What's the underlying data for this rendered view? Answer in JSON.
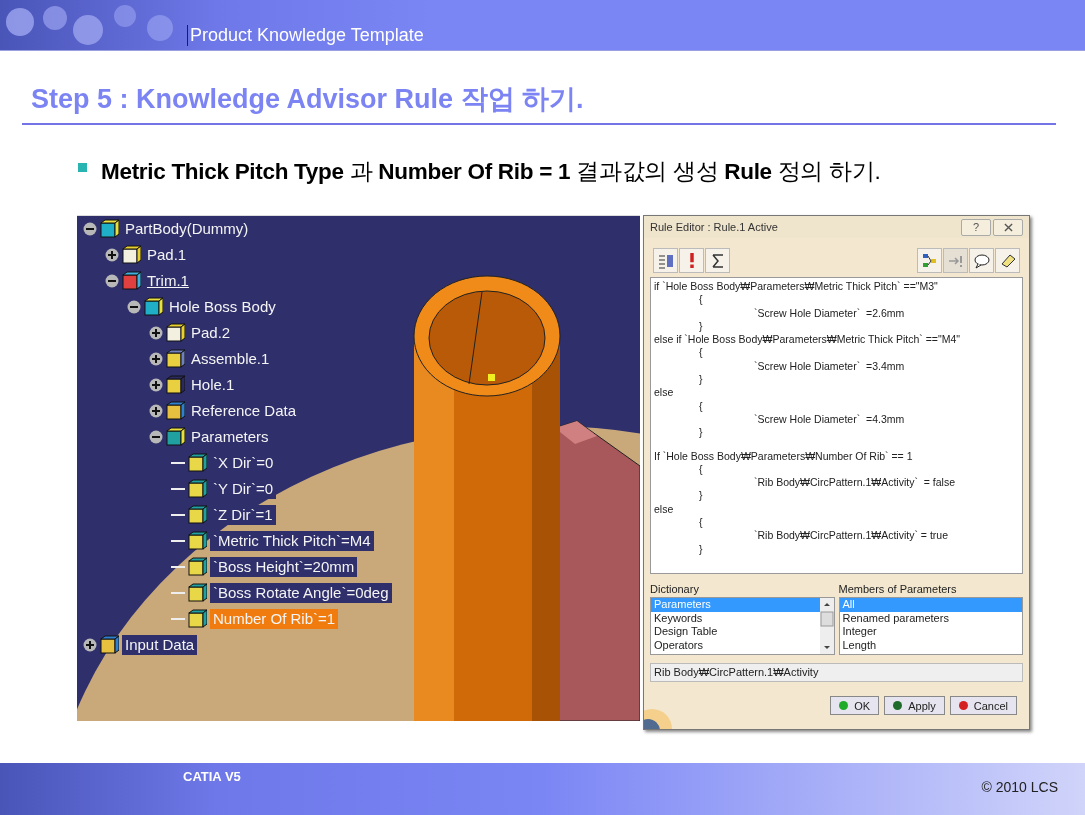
{
  "header": {
    "title": "Product Knowledge Template"
  },
  "heading": "Step 5 : Knowledge Advisor  Rule 작업 하기.",
  "bullet": "**Metric Thick Pitch Type** 과 **Number Of Rib = 1** 결과값의 생성 **Rule** 정의 하기.",
  "tree": [
    {
      "label": "PartBody(Dummy)",
      "kind": "body",
      "expanded": true,
      "selected": false,
      "children": [
        {
          "label": "Pad.1",
          "kind": "pad",
          "expanded": false,
          "selected": false
        },
        {
          "label": "Trim.1",
          "kind": "trim",
          "expanded": true,
          "selected": false,
          "in_work": true,
          "children": [
            {
              "label": "Hole Boss Body",
              "kind": "body",
              "expanded": true,
              "selected": false,
              "children": [
                {
                  "label": "Pad.2",
                  "kind": "pad",
                  "expanded": false,
                  "selected": false
                },
                {
                  "label": "Assemble.1",
                  "kind": "assemble",
                  "expanded": false,
                  "selected": false
                },
                {
                  "label": "Hole.1",
                  "kind": "hole",
                  "expanded": false,
                  "selected": false
                },
                {
                  "label": "Reference Data",
                  "kind": "reference",
                  "expanded": false,
                  "selected": false
                },
                {
                  "label": "Parameters",
                  "kind": "parameters",
                  "expanded": true,
                  "selected": false,
                  "children": [
                    {
                      "label": "`X Dir`=0",
                      "kind": "param",
                      "selected": false
                    },
                    {
                      "label": "`Y Dir`=0",
                      "kind": "param",
                      "selected": false
                    },
                    {
                      "label": "`Z Dir`=1",
                      "kind": "param",
                      "selected": false
                    },
                    {
                      "label": "`Metric Thick Pitch`=M4",
                      "kind": "param",
                      "selected": false
                    },
                    {
                      "label": "`Boss Height`=20mm",
                      "kind": "param",
                      "selected": false
                    },
                    {
                      "label": "`Boss Rotate Angle`=0deg",
                      "kind": "param",
                      "selected": false
                    },
                    {
                      "label": "Number Of Rib`=1",
                      "kind": "param",
                      "selected": true
                    }
                  ]
                }
              ]
            }
          ]
        }
      ]
    },
    {
      "label": "Input Data",
      "kind": "reference",
      "expanded": false,
      "selected": false
    }
  ],
  "dialog": {
    "title": "Rule Editor : Rule.1 Active",
    "help": "?",
    "tools_left": [
      {
        "kind": "list",
        "disabled": false
      },
      {
        "kind": "error",
        "disabled": false
      },
      {
        "kind": "sum",
        "disabled": false
      }
    ],
    "tools_right": [
      {
        "kind": "graph",
        "disabled": false
      },
      {
        "kind": "goto",
        "disabled": true
      },
      {
        "kind": "bubble",
        "disabled": false
      },
      {
        "kind": "eraser",
        "disabled": false
      }
    ],
    "code": [
      {
        "kind": "cond",
        "text": "if `Hole Boss Body₩Parameters₩Metric Thick Pitch` ==\"M3\""
      },
      {
        "kind": "brace",
        "text": "{"
      },
      {
        "kind": "stmt",
        "text": "`Screw Hole Diameter`  =2.6mm"
      },
      {
        "kind": "brace",
        "text": "}"
      },
      {
        "kind": "cond",
        "text": "else if `Hole Boss Body₩Parameters₩Metric Thick Pitch` ==\"M4\""
      },
      {
        "kind": "brace",
        "text": "{"
      },
      {
        "kind": "stmt",
        "text": "`Screw Hole Diameter`  =3.4mm"
      },
      {
        "kind": "brace",
        "text": "}"
      },
      {
        "kind": "cond",
        "text": "else"
      },
      {
        "kind": "brace",
        "text": "{"
      },
      {
        "kind": "stmt",
        "text": "`Screw Hole Diameter`  =4.3mm"
      },
      {
        "kind": "brace",
        "text": "}"
      },
      {
        "kind": "section",
        "text": "If `Hole Boss Body₩Parameters₩Number Of Rib` == 1"
      },
      {
        "kind": "brace",
        "text": "{"
      },
      {
        "kind": "stmt",
        "text": "`Rib Body₩CircPattern.1₩Activity`  = false"
      },
      {
        "kind": "brace",
        "text": "}"
      },
      {
        "kind": "cond",
        "text": "else"
      },
      {
        "kind": "brace",
        "text": "{"
      },
      {
        "kind": "stmt",
        "text": "`Rib Body₩CircPattern.1₩Activity` = true"
      },
      {
        "kind": "brace",
        "text": "}"
      }
    ],
    "dictionary": {
      "label": "Dictionary",
      "items": [
        {
          "label": "Parameters",
          "selected": true
        },
        {
          "label": "Keywords",
          "selected": false
        },
        {
          "label": "Design Table",
          "selected": false
        },
        {
          "label": "Operators",
          "selected": false
        }
      ]
    },
    "members": {
      "label": "Members of Parameters",
      "items": [
        {
          "label": "All",
          "selected": true
        },
        {
          "label": "Renamed parameters",
          "selected": false
        },
        {
          "label": "Integer",
          "selected": false
        },
        {
          "label": "Length",
          "selected": false
        }
      ]
    },
    "path_field": "Rib Body₩CircPattern.1₩Activity",
    "buttons": [
      {
        "label": "OK",
        "color": "#1faa2a"
      },
      {
        "label": "Apply",
        "color": "#1e6b2a"
      },
      {
        "label": "Cancel",
        "color": "#d42020"
      }
    ]
  },
  "footer": {
    "left": "CATIA V5",
    "right": "© 2010 LCS"
  }
}
